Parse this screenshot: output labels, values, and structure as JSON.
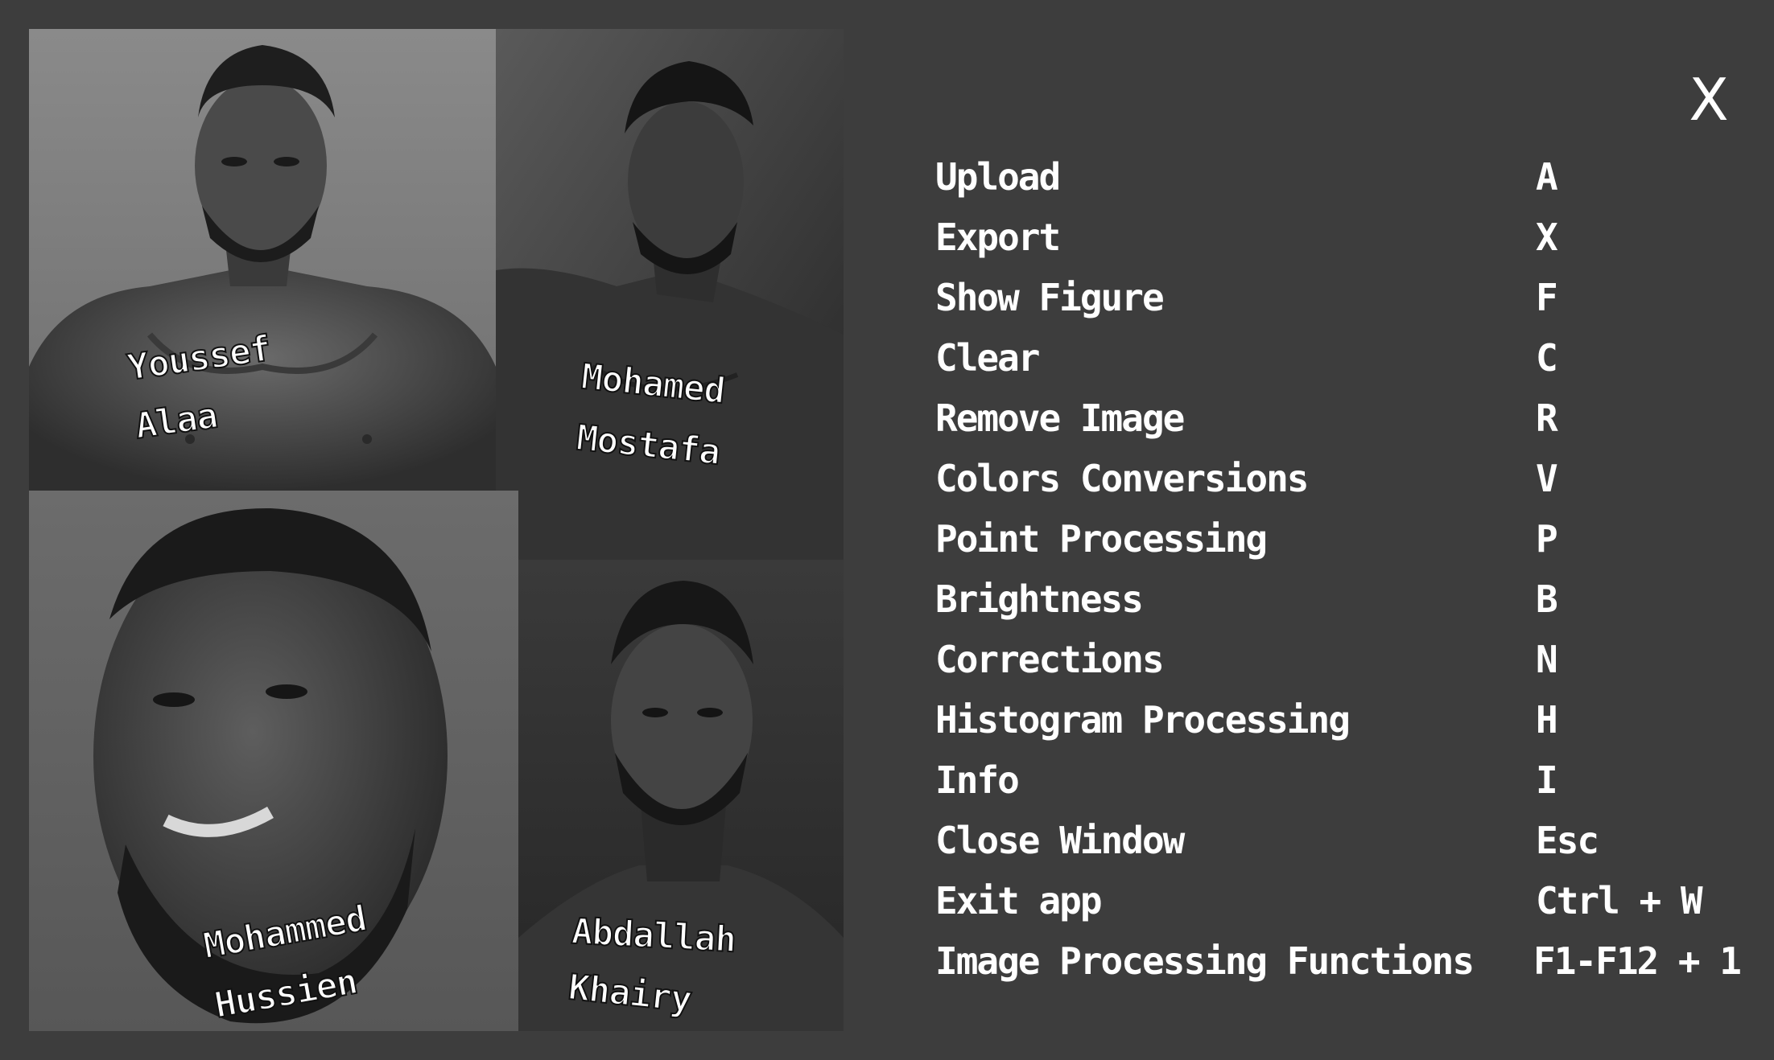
{
  "window": {
    "close_label": "X"
  },
  "credits": [
    {
      "first": "Youssef",
      "last": "Alaa"
    },
    {
      "first": "Mohamed",
      "last": "Mostafa"
    },
    {
      "first": "Mohammed",
      "last": "Hussien"
    },
    {
      "first": "Abdallah",
      "last": "Khairy"
    }
  ],
  "shortcuts": [
    {
      "action": "Upload",
      "key": "A"
    },
    {
      "action": "Export",
      "key": "X"
    },
    {
      "action": "Show Figure",
      "key": "F"
    },
    {
      "action": "Clear",
      "key": "C"
    },
    {
      "action": "Remove Image",
      "key": "R"
    },
    {
      "action": "Colors Conversions",
      "key": "V"
    },
    {
      "action": "Point Processing",
      "key": "P"
    },
    {
      "action": "Brightness",
      "key": "B"
    },
    {
      "action": "Corrections",
      "key": "N"
    },
    {
      "action": "Histogram Processing",
      "key": "H"
    },
    {
      "action": "Info",
      "key": "I"
    },
    {
      "action": "Close Window",
      "key": "Esc"
    },
    {
      "action": "Exit app",
      "key": "Ctrl + W"
    },
    {
      "action": "Image Processing Functions",
      "key": "F1-F12 + 1"
    }
  ],
  "colors": {
    "background": "#3d3d3d",
    "text": "#ffffff"
  }
}
